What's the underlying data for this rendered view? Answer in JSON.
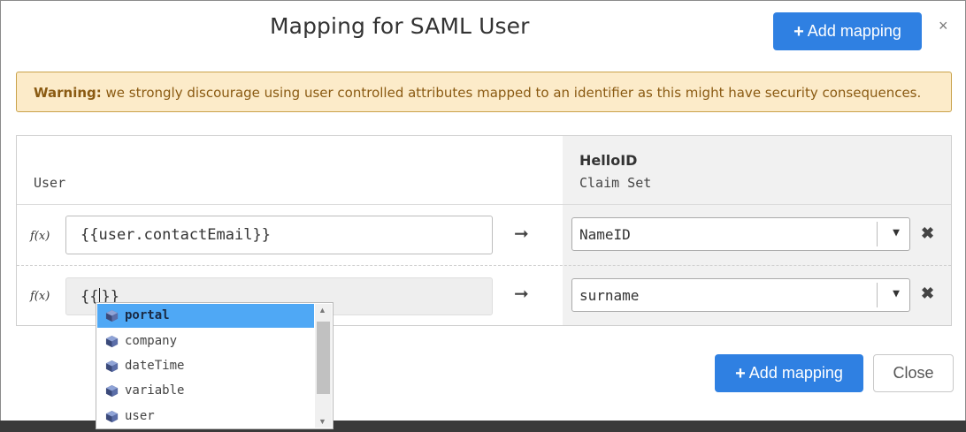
{
  "modal": {
    "title": "Mapping for SAML User",
    "close_glyph": "×",
    "add_mapping_label": "Add mapping",
    "close_label": "Close"
  },
  "warning": {
    "label": "Warning:",
    "text": " we strongly discourage using user controlled attributes mapped to an identifier as this might have security consequences."
  },
  "table": {
    "user_header": "User",
    "helloid_title": "HelloID",
    "helloid_subtitle": "Claim Set",
    "rows": [
      {
        "fx": "f(x)",
        "expression": "{{user.contactEmail}}",
        "arrow": "➞",
        "claim": "NameID"
      },
      {
        "fx": "f(x)",
        "expression_before": "{{",
        "expression_after": "}}",
        "arrow": "➞",
        "claim": "surname"
      }
    ]
  },
  "autocomplete": {
    "items": [
      "portal",
      "company",
      "dateTime",
      "variable",
      "user"
    ],
    "selected_index": 0
  },
  "icons": {
    "plus": "plus-icon",
    "close": "close-icon",
    "arrow": "arrow-right-icon",
    "chevron": "chevron-down-icon",
    "remove": "remove-icon",
    "object": "object-cube-icon"
  },
  "colors": {
    "primary": "#2f80e2",
    "warning_bg": "#fcebc9",
    "warning_text": "#8a5a12",
    "selected_item": "#4fa8f5"
  }
}
